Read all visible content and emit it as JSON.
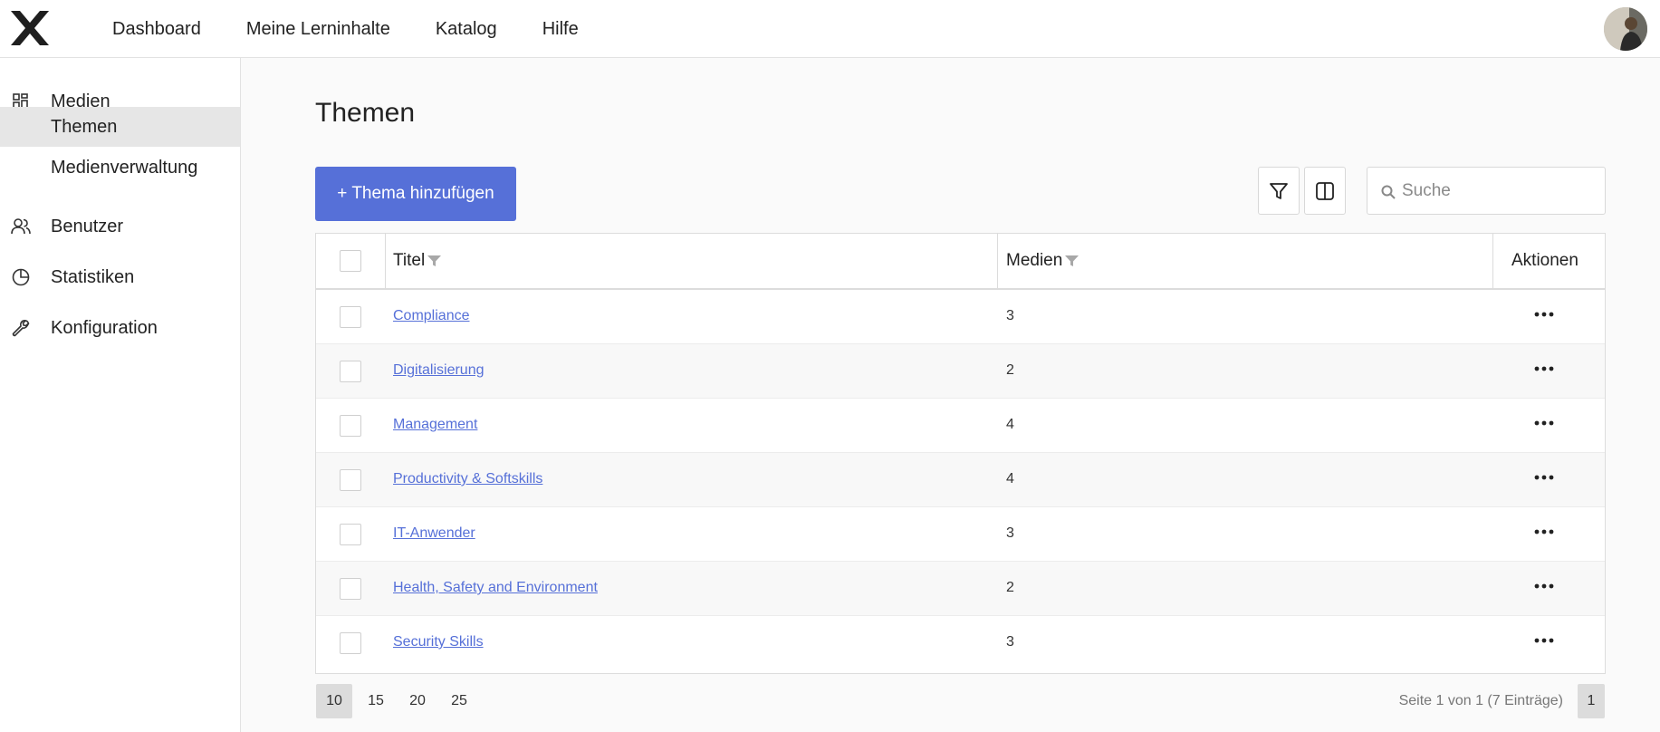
{
  "header": {
    "logo_icon": "x-logo-icon",
    "nav": [
      {
        "label": "Dashboard"
      },
      {
        "label": "Meine Lerninhalte"
      },
      {
        "label": "Katalog"
      },
      {
        "label": "Hilfe"
      }
    ]
  },
  "sidebar": {
    "items": [
      {
        "label": "Medien",
        "icon": "grid-icon"
      },
      {
        "label": "Themen",
        "active": true
      },
      {
        "label": "Medienverwaltung"
      },
      {
        "label": "Benutzer",
        "icon": "users-icon"
      },
      {
        "label": "Statistiken",
        "icon": "pie-chart-icon"
      },
      {
        "label": "Konfiguration",
        "icon": "wrench-icon"
      }
    ]
  },
  "main": {
    "title": "Themen",
    "add_button": "+ Thema hinzufügen",
    "search_placeholder": "Suche",
    "accent_color": "#5670d8"
  },
  "table": {
    "columns": {
      "title": "Titel",
      "media": "Medien",
      "actions": "Aktionen"
    },
    "rows": [
      {
        "title": "Compliance",
        "count": "3"
      },
      {
        "title": "Digitalisierung",
        "count": "2"
      },
      {
        "title": "Management",
        "count": "4"
      },
      {
        "title": "Productivity & Softskills",
        "count": "4"
      },
      {
        "title": "IT-Anwender",
        "count": "3"
      },
      {
        "title": "Health, Safety and Environment",
        "count": "2"
      },
      {
        "title": "Security Skills",
        "count": "3"
      }
    ]
  },
  "pagination": {
    "page_sizes": [
      "10",
      "15",
      "20",
      "25"
    ],
    "active_size": "10",
    "info": "Seite 1 von 1 (7 Einträge)",
    "current_page": "1"
  }
}
